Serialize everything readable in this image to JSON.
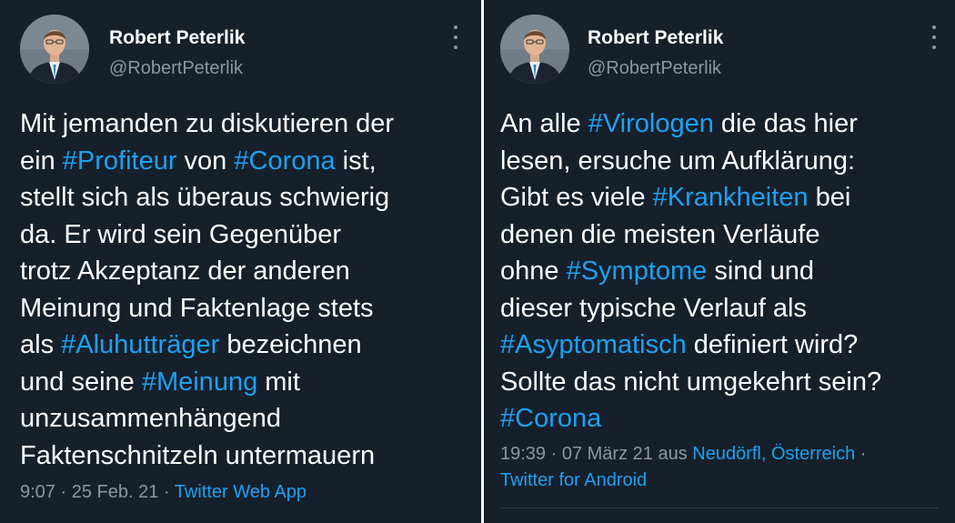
{
  "left_tweet": {
    "author_name": "Robert Peterlik",
    "author_handle": "@RobertPeterlik",
    "lines": [
      [
        {
          "t": "Mit jemanden zu diskutieren der",
          "tag": false
        }
      ],
      [
        {
          "t": "ein ",
          "tag": false
        },
        {
          "t": "#Profiteur",
          "tag": true
        },
        {
          "t": " von ",
          "tag": false
        },
        {
          "t": "#Corona",
          "tag": true
        },
        {
          "t": " ist,",
          "tag": false
        }
      ],
      [
        {
          "t": "stellt sich als überaus schwierig",
          "tag": false
        }
      ],
      [
        {
          "t": "da. Er wird sein Gegenüber",
          "tag": false
        }
      ],
      [
        {
          "t": "trotz Akzeptanz der anderen",
          "tag": false
        }
      ],
      [
        {
          "t": "Meinung und Faktenlage stets",
          "tag": false
        }
      ],
      [
        {
          "t": "als ",
          "tag": false
        },
        {
          "t": "#Aluhutträger",
          "tag": true
        },
        {
          "t": " bezeichnen",
          "tag": false
        }
      ],
      [
        {
          "t": "und seine ",
          "tag": false
        },
        {
          "t": "#Meinung",
          "tag": true
        },
        {
          "t": " mit",
          "tag": false
        }
      ],
      [
        {
          "t": "unzusammenhängend",
          "tag": false
        }
      ],
      [
        {
          "t": "Faktenschnitzeln untermauern",
          "tag": false
        }
      ]
    ],
    "time": "9:07",
    "sep": " · ",
    "date": "25 Feb. 21",
    "source": "Twitter Web App"
  },
  "right_tweet": {
    "author_name": "Robert Peterlik",
    "author_handle": "@RobertPeterlik",
    "lines": [
      [
        {
          "t": "An alle ",
          "tag": false
        },
        {
          "t": "#Virologen",
          "tag": true
        },
        {
          "t": " die das hier",
          "tag": false
        }
      ],
      [
        {
          "t": "lesen, ersuche um Aufklärung:",
          "tag": false
        }
      ],
      [
        {
          "t": "Gibt es viele ",
          "tag": false
        },
        {
          "t": "#Krankheiten",
          "tag": true
        },
        {
          "t": " bei",
          "tag": false
        }
      ],
      [
        {
          "t": "denen die meisten Verläufe",
          "tag": false
        }
      ],
      [
        {
          "t": "ohne ",
          "tag": false
        },
        {
          "t": "#Symptome",
          "tag": true
        },
        {
          "t": " sind und",
          "tag": false
        }
      ],
      [
        {
          "t": "dieser typische Verlauf als",
          "tag": false
        }
      ],
      [
        {
          "t": "#Asyptomatisch",
          "tag": true
        },
        {
          "t": " definiert wird?",
          "tag": false
        }
      ],
      [
        {
          "t": "Sollte das nicht umgekehrt sein?",
          "tag": false
        }
      ],
      [
        {
          "t": "#Corona",
          "tag": true
        }
      ]
    ],
    "time": "19:39",
    "sep": " · ",
    "date": "07 März 21",
    "aus": " aus ",
    "location": "Neudörfl, Österreich",
    "sep_trailing": " ·",
    "source": "Twitter for Android"
  },
  "icons": {
    "more": "more-vertical-icon",
    "avatar": "profile-photo"
  },
  "colors": {
    "background": "#15202b",
    "text": "#ffffff",
    "muted": "#8899a6",
    "accent": "#1da1f2"
  }
}
